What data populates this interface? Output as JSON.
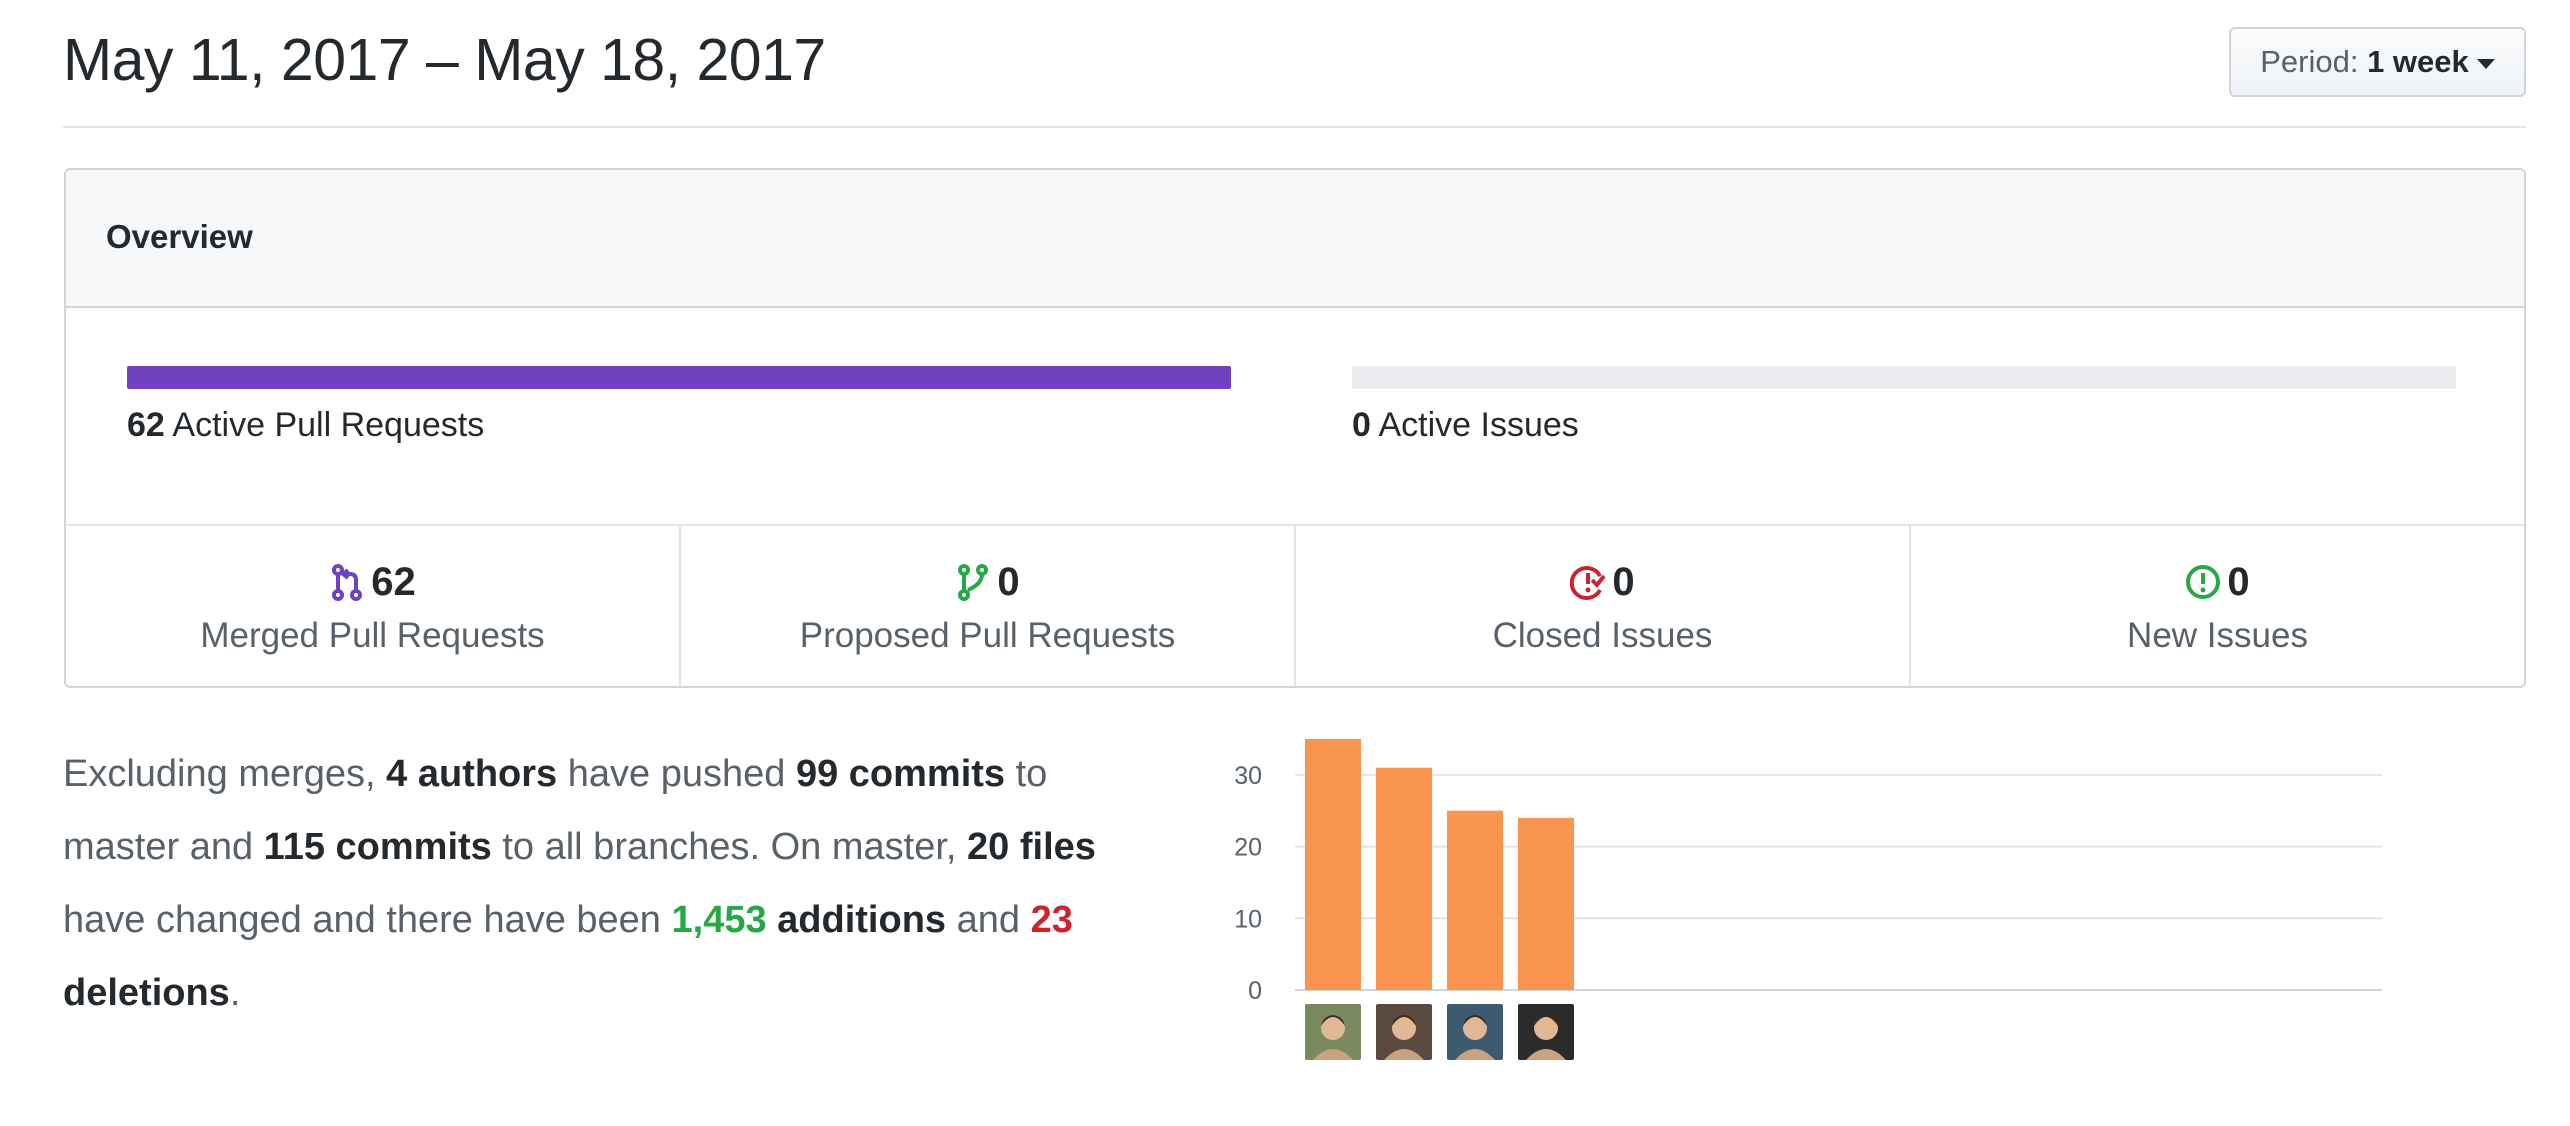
{
  "header": {
    "date_range": "May 11, 2017 – May 18, 2017",
    "period_label": "Period:",
    "period_value": "1 week"
  },
  "overview": {
    "title": "Overview",
    "active_prs": {
      "count": "62",
      "label": "Active Pull Requests",
      "fill_fraction": 1.0,
      "color": "#6f42c1"
    },
    "active_issues": {
      "count": "0",
      "label": "Active Issues",
      "fill_fraction": 0.0
    },
    "stats": [
      {
        "icon": "git-merge-icon",
        "count": "62",
        "label": "Merged Pull Requests",
        "color": "#6f42c1"
      },
      {
        "icon": "git-pull-request-icon",
        "count": "0",
        "label": "Proposed Pull Requests",
        "color": "#28a745"
      },
      {
        "icon": "issue-closed-icon",
        "count": "0",
        "label": "Closed Issues",
        "color": "#cb2431"
      },
      {
        "icon": "issue-opened-icon",
        "count": "0",
        "label": "New Issues",
        "color": "#28a745"
      }
    ]
  },
  "summary": {
    "t1": "Excluding merges, ",
    "authors": "4 authors",
    "t2": " have pushed ",
    "commits_master": "99 commits",
    "t3": " to master and ",
    "commits_all": "115 commits",
    "t4": " to all branches. On master, ",
    "files": "20 files",
    "t5": " have changed and there have been ",
    "additions_num": "1,453",
    "additions_word": " additions",
    "t6": " and ",
    "deletions_num": "23",
    "deletions_word": "deletions",
    "t7": "."
  },
  "chart_data": {
    "type": "bar",
    "categories": [
      "author-1",
      "author-2",
      "author-3",
      "author-4"
    ],
    "values": [
      35,
      31,
      25,
      24
    ],
    "ylim": [
      0,
      35
    ],
    "yticks": [
      0,
      10,
      20,
      30
    ],
    "grid": true,
    "bar_color": "#f9954e"
  },
  "avatars": [
    {
      "name": "author-avatar-1",
      "bg": "#7a8a5e"
    },
    {
      "name": "author-avatar-2",
      "bg": "#5b4a3f"
    },
    {
      "name": "author-avatar-3",
      "bg": "#3d5a6e"
    },
    {
      "name": "author-avatar-4",
      "bg": "#2b2b2b"
    }
  ]
}
